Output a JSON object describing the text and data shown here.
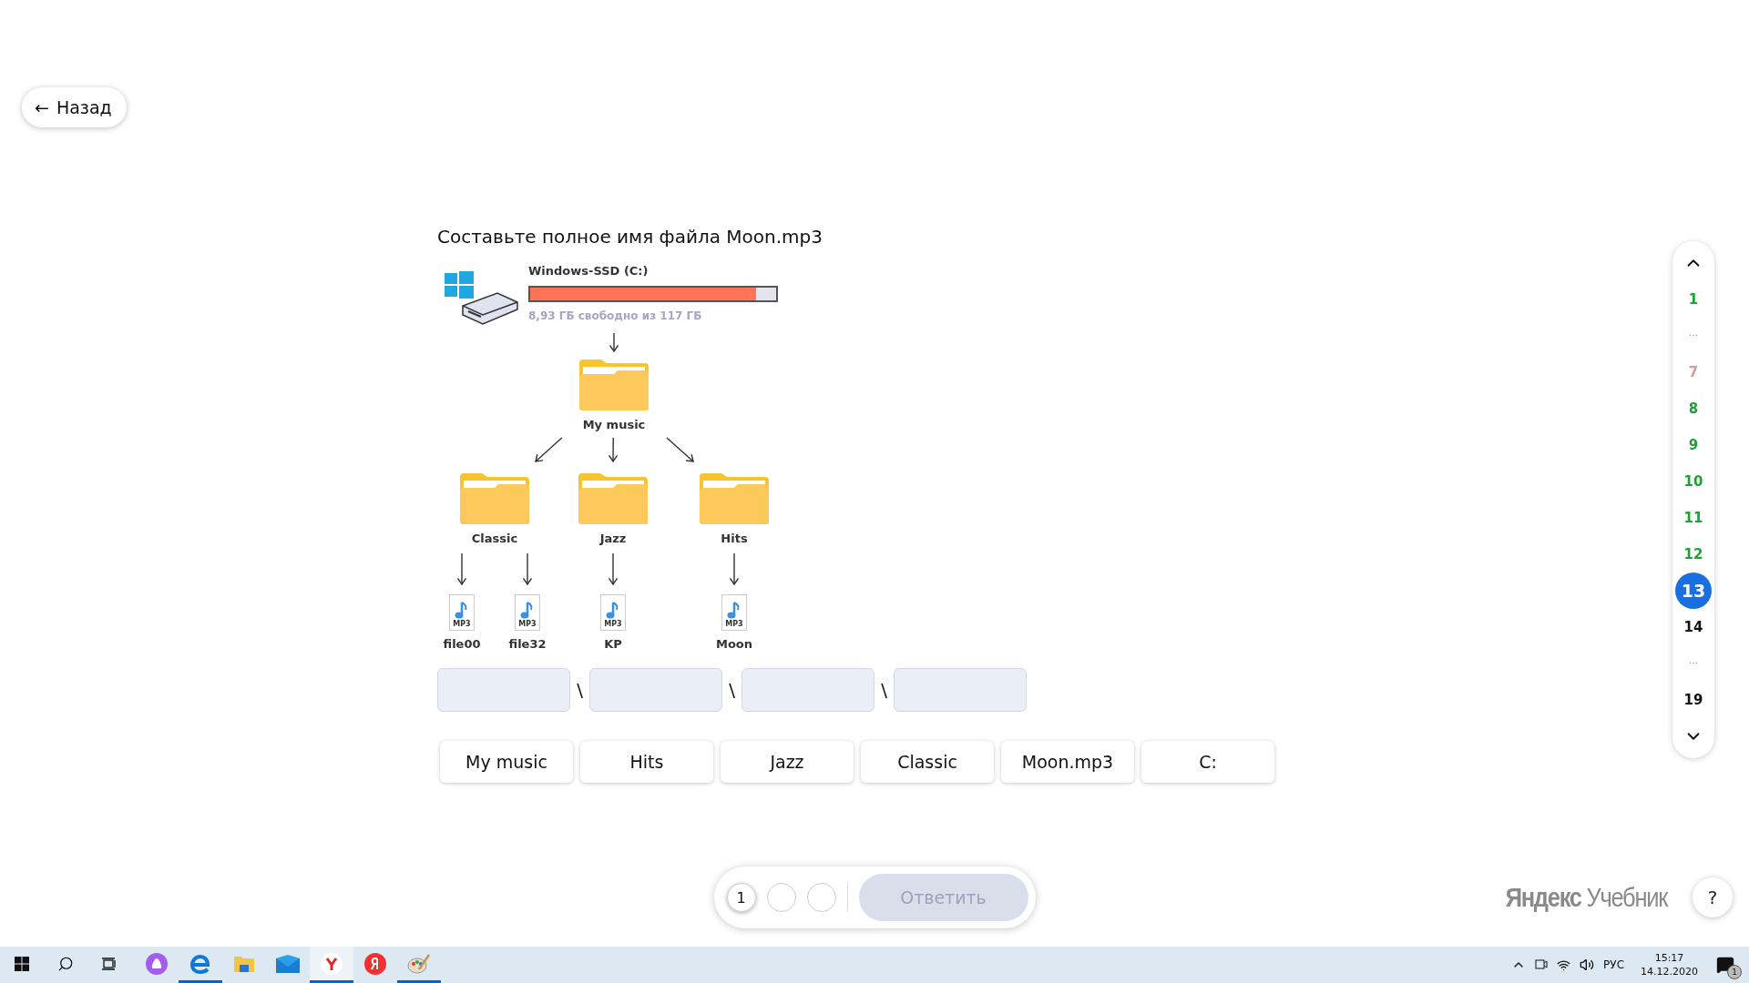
{
  "back_button": {
    "icon": "←",
    "label": "Назад"
  },
  "task": {
    "title": "Составьте полное имя файла Moon.mp3",
    "diagram": {
      "drive": {
        "label": "Windows-SSD (C:)",
        "level": 0.92,
        "free_space": "8,93 ГБ свободно из 117 ГБ"
      },
      "children": [
        {
          "kind": "folder",
          "name": "My music",
          "children": [
            {
              "kind": "folder",
              "name": "Classic",
              "children": [
                {
                  "kind": "file",
                  "name": "file00",
                  "badge": "MP3"
                },
                {
                  "kind": "file",
                  "name": "file32",
                  "badge": "MP3"
                }
              ]
            },
            {
              "kind": "folder",
              "name": "Jazz",
              "children": [
                {
                  "kind": "file",
                  "name": "KP",
                  "badge": "MP3"
                }
              ]
            },
            {
              "kind": "folder",
              "name": "Hits",
              "children": [
                {
                  "kind": "file",
                  "name": "Moon",
                  "badge": "MP3"
                }
              ]
            }
          ]
        }
      ]
    },
    "answer_slots": [
      {
        "filled": false
      },
      {
        "filled": false
      },
      {
        "filled": false
      },
      {
        "filled": false
      }
    ],
    "separator": "\\",
    "options": [
      "My music",
      "Hits",
      "Jazz",
      "Classic",
      "Moon.mp3",
      "C:"
    ]
  },
  "attempts": [
    {
      "label": "1",
      "selected": true
    },
    {
      "selected": false
    },
    {
      "selected": false
    }
  ],
  "submit_button": {
    "label": "Ответить",
    "disabled": true
  },
  "logo": "**Яндекс** Учебник",
  "help_button": "?",
  "task_nav": [
    {
      "kind": "up"
    },
    {
      "kind": "number",
      "label": "1",
      "color": "#21a038",
      "selected": false
    },
    {
      "kind": "gap",
      "label": "..."
    },
    {
      "kind": "number",
      "label": "7",
      "color": "#d99a9a",
      "selected": false
    },
    {
      "kind": "number",
      "label": "8",
      "color": "#21a038",
      "selected": false
    },
    {
      "kind": "number",
      "label": "9",
      "color": "#21a038",
      "selected": false
    },
    {
      "kind": "number",
      "label": "10",
      "color": "#21a038",
      "selected": false
    },
    {
      "kind": "number",
      "label": "11",
      "color": "#21a038",
      "selected": false
    },
    {
      "kind": "number",
      "label": "12",
      "color": "#21a038",
      "selected": false
    },
    {
      "kind": "number",
      "label": "13",
      "selected": true
    },
    {
      "kind": "number",
      "label": "14",
      "color": "#111111",
      "selected": false
    },
    {
      "kind": "gap",
      "label": "..."
    },
    {
      "kind": "number",
      "label": "19",
      "color": "#111111",
      "selected": false
    },
    {
      "kind": "down"
    }
  ],
  "taskbar": {
    "apps": [
      {
        "kind": "start",
        "running": false,
        "selected": false
      },
      {
        "kind": "search",
        "running": false,
        "selected": false
      },
      {
        "kind": "taskview",
        "running": false,
        "selected": false
      },
      {
        "kind": "assistant",
        "running": false,
        "selected": false
      },
      {
        "kind": "edge",
        "running": true,
        "selected": false
      },
      {
        "kind": "files",
        "running": false,
        "selected": false
      },
      {
        "kind": "mail",
        "running": false,
        "selected": false
      },
      {
        "kind": "browser",
        "running": true,
        "selected": true
      },
      {
        "kind": "redlogo",
        "running": false,
        "selected": false
      },
      {
        "kind": "paint",
        "running": true,
        "selected": false
      }
    ],
    "language": "РУС",
    "time": "15:17",
    "date": "14.12.2020",
    "notifications": "1"
  }
}
